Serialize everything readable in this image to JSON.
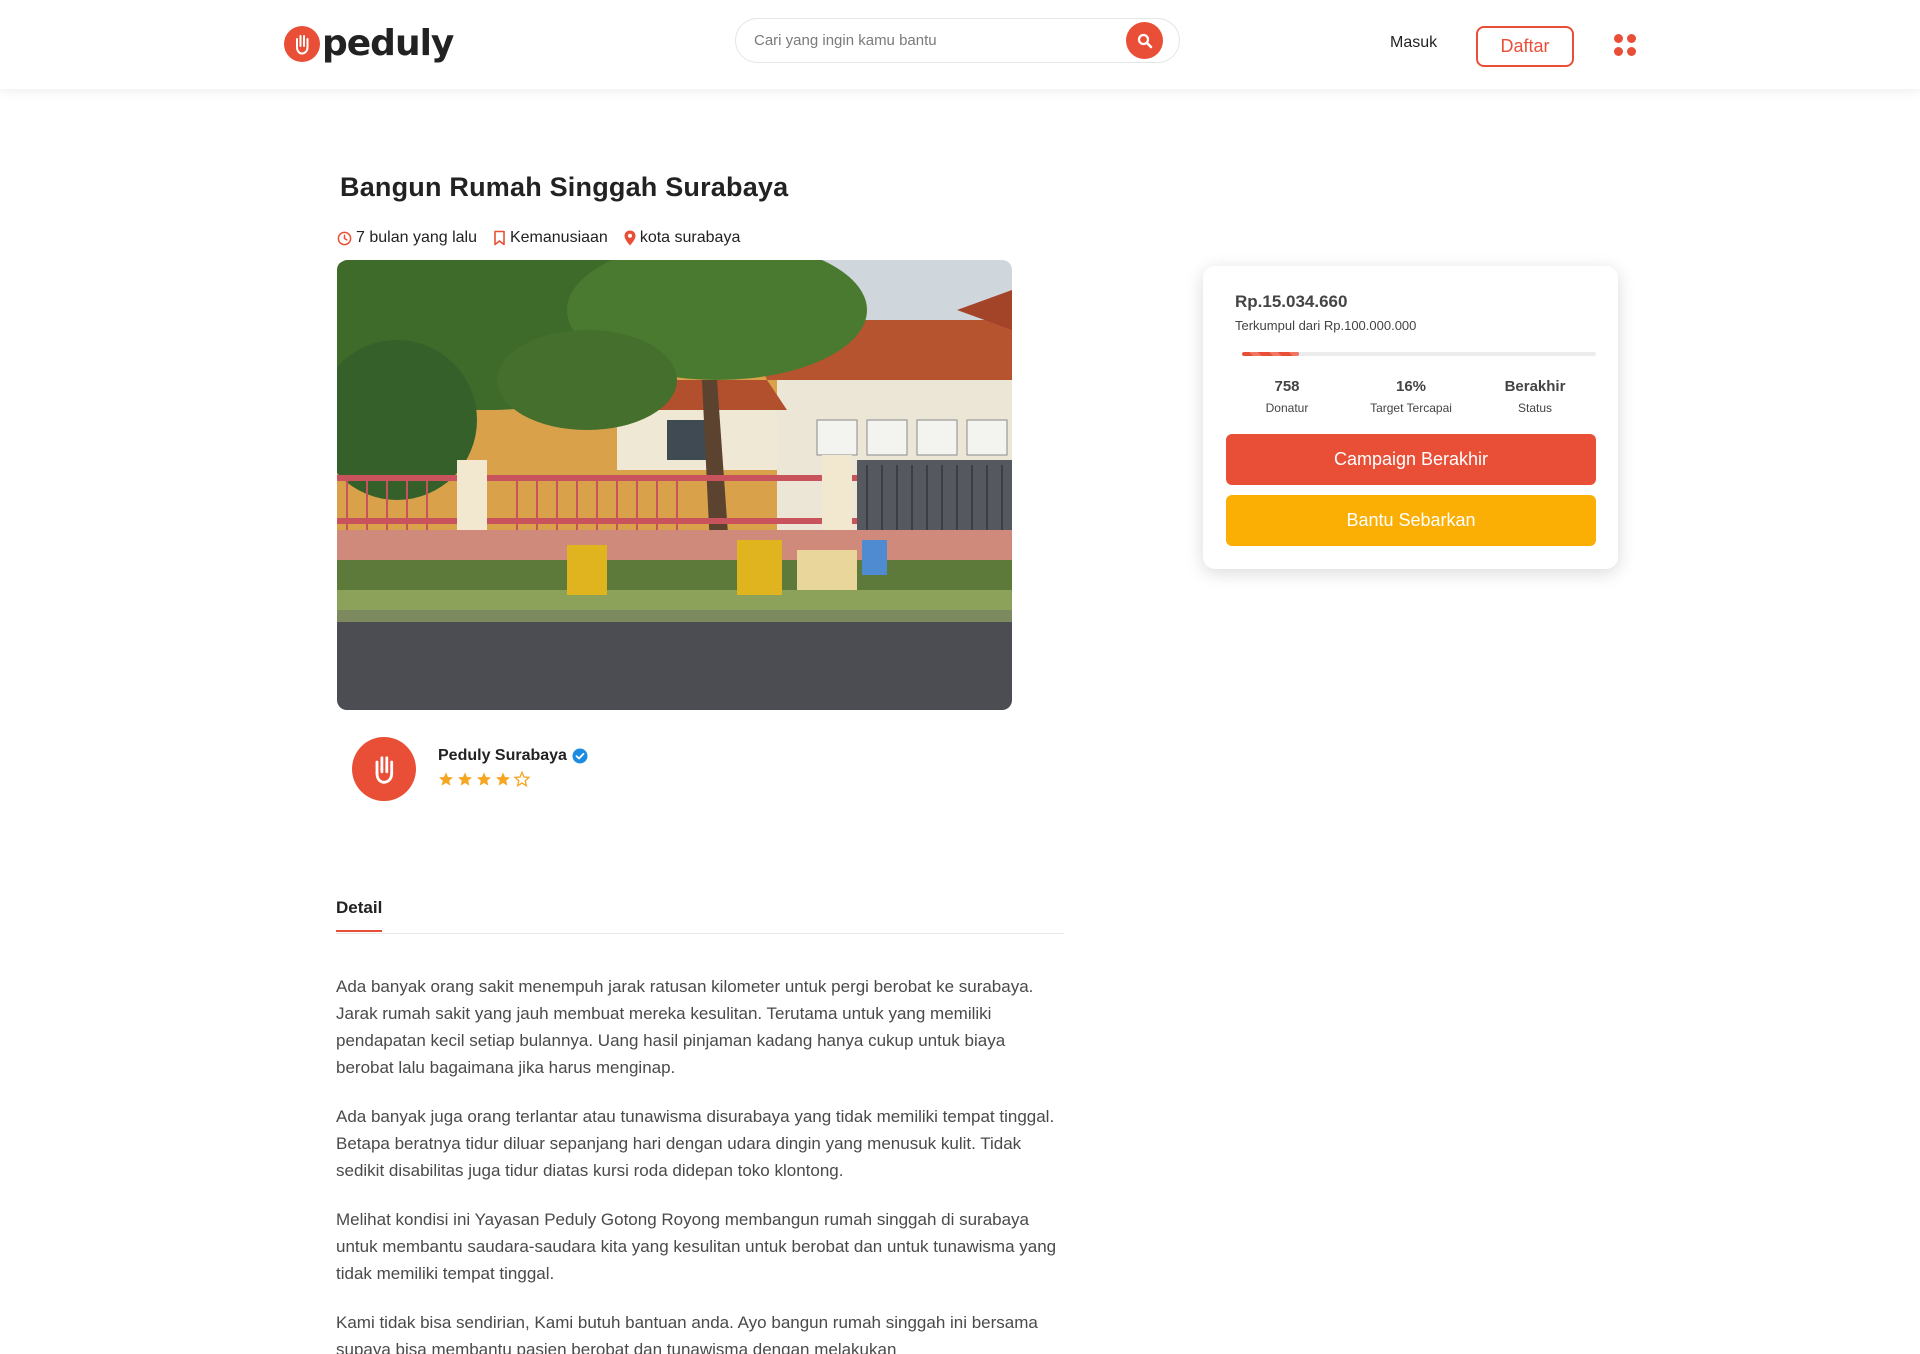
{
  "brand": {
    "name": "peduly",
    "accent": "#e94f37",
    "secondary": "#fbae03",
    "logo_icon": "hand-icon"
  },
  "header": {
    "search_placeholder": "Cari yang ingin kamu bantu",
    "login_label": "Masuk",
    "register_label": "Daftar"
  },
  "campaign": {
    "title": "Bangun Rumah Singgah Surabaya",
    "time_ago": "7 bulan yang lalu",
    "category": "Kemanusiaan",
    "location": "kota surabaya",
    "image_description_icon": "house-photo"
  },
  "organizer": {
    "name": "Peduly Surabaya",
    "verified": true,
    "rating": 4,
    "rating_max": 5
  },
  "tabs": {
    "detail": "Detail"
  },
  "article": {
    "paragraphs": [
      "Ada banyak orang sakit menempuh jarak ratusan kilometer untuk pergi berobat ke surabaya. Jarak rumah sakit yang jauh membuat mereka kesulitan. Terutama untuk yang memiliki pendapatan kecil setiap bulannya. Uang hasil pinjaman kadang hanya cukup untuk biaya berobat lalu bagaimana jika harus menginap.",
      "Ada banyak juga orang terlantar atau tunawisma disurabaya yang tidak memiliki tempat tinggal. Betapa beratnya tidur diluar sepanjang hari dengan udara dingin yang menusuk kulit. Tidak sedikit disabilitas juga tidur diatas kursi roda didepan toko klontong.",
      "Melihat kondisi ini Yayasan Peduly Gotong Royong membangun rumah singgah di surabaya untuk membantu saudara-saudara kita yang kesulitan untuk berobat dan untuk tunawisma yang tidak memiliki tempat tinggal.",
      "Kami tidak bisa sendirian, Kami butuh bantuan anda. Ayo bangun rumah singgah ini bersama supaya bisa membantu pasien berobat dan tunawisma dengan melakukan"
    ]
  },
  "donation": {
    "amount": "Rp.15.034.660",
    "collected_text": "Terkumpul dari Rp.100.000.000",
    "progress_percent": 16,
    "donors": "758",
    "donors_label": "Donatur",
    "target": "16%",
    "target_label": "Target Tercapai",
    "status": "Berakhir",
    "status_label": "Status",
    "ended_button": "Campaign Berakhir",
    "share_button": "Bantu Sebarkan"
  }
}
